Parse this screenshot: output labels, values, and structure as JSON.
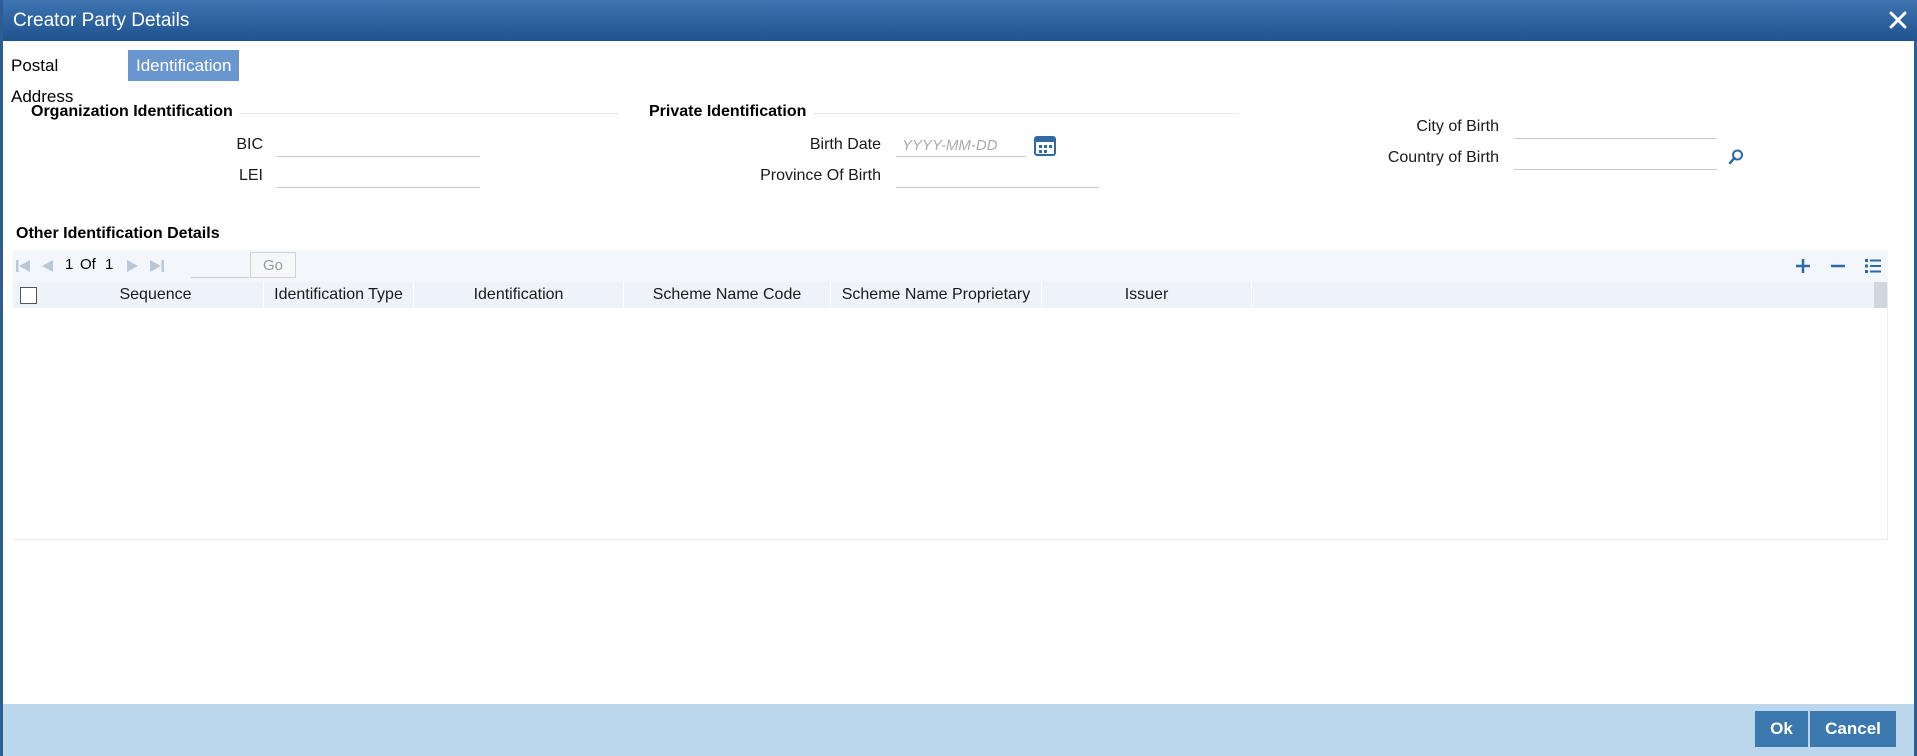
{
  "window": {
    "title": "Creator Party Details"
  },
  "tabs": [
    {
      "label": "Postal Address",
      "active": false
    },
    {
      "label": "Identification",
      "active": true
    }
  ],
  "organization": {
    "title": "Organization Identification",
    "bic_label": "BIC",
    "bic_value": "",
    "lei_label": "LEI",
    "lei_value": ""
  },
  "private": {
    "title": "Private Identification",
    "birth_date_label": "Birth Date",
    "birth_date_placeholder": "YYYY-MM-DD",
    "province_label": "Province Of Birth",
    "province_value": ""
  },
  "birth_place": {
    "city_label": "City of Birth",
    "city_value": "",
    "country_label": "Country of Birth",
    "country_value": ""
  },
  "other": {
    "title": "Other Identification Details",
    "pager": {
      "current": "1",
      "of_label": "Of",
      "total": "1",
      "go_label": "Go"
    },
    "columns": [
      "Sequence",
      "Identification Type",
      "Identification",
      "Scheme Name Code",
      "Scheme Name Proprietary",
      "Issuer"
    ],
    "rows": []
  },
  "footer": {
    "ok_label": "Ok",
    "cancel_label": "Cancel"
  },
  "colors": {
    "title_bar": "#2c5e94",
    "active_tab": "#6996cf",
    "footer": "#bcd7ec",
    "button": "#3b78ad",
    "grid_header": "#eef3f9"
  },
  "icons": {
    "close": "close-icon",
    "calendar": "calendar-icon",
    "search": "search-icon",
    "first": "first-page-icon",
    "prev": "prev-page-icon",
    "next": "next-page-icon",
    "last": "last-page-icon",
    "add": "add-row-icon",
    "remove": "remove-row-icon",
    "details": "row-details-icon"
  }
}
